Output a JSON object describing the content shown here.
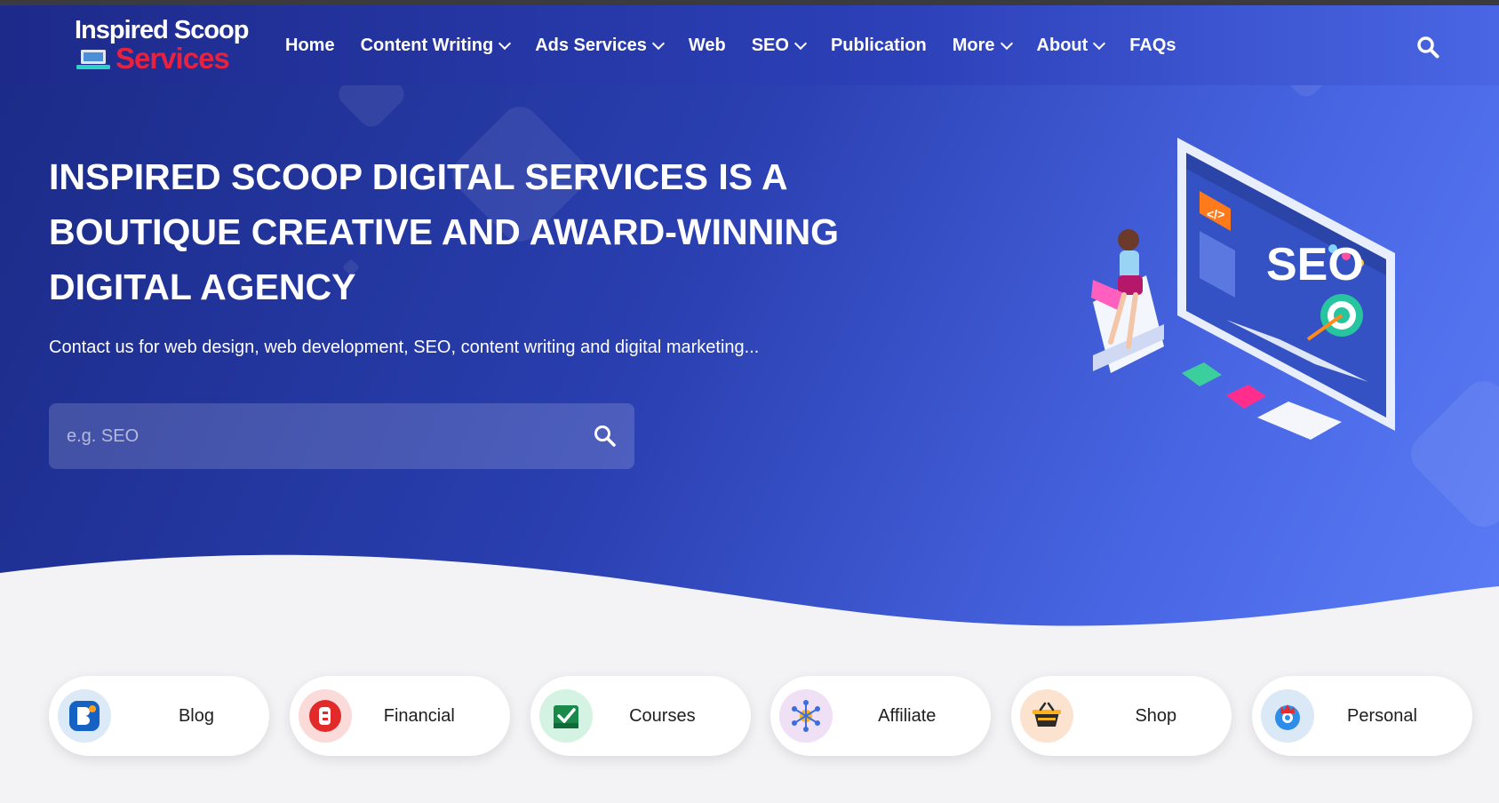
{
  "brand": {
    "logo_top": "Inspired Scoop",
    "logo_bottom": "Services",
    "logo_icon": "laptop-icon"
  },
  "nav": {
    "items": [
      {
        "label": "Home",
        "dropdown": false
      },
      {
        "label": "Content Writing",
        "dropdown": true
      },
      {
        "label": "Ads Services",
        "dropdown": true
      },
      {
        "label": "Web",
        "dropdown": false
      },
      {
        "label": "SEO",
        "dropdown": true
      },
      {
        "label": "Publication",
        "dropdown": false
      },
      {
        "label": "More",
        "dropdown": true
      },
      {
        "label": "About",
        "dropdown": true
      },
      {
        "label": "FAQs",
        "dropdown": false
      }
    ],
    "search_icon": "search-icon"
  },
  "hero": {
    "headline": "INSPIRED SCOOP DIGITAL SERVICES IS A BOUTIQUE CREATIVE AND AWARD-WINNING DIGITAL AGENCY",
    "subline": "Contact us for web design, web development, SEO, content writing and digital marketing...",
    "search_placeholder": "e.g. SEO",
    "illustration_text": "SEO"
  },
  "categories": [
    {
      "label": "Blog",
      "icon": "blog-icon",
      "bg": "#dce9f7"
    },
    {
      "label": "Financial",
      "icon": "blogger-icon",
      "bg": "#fbdada"
    },
    {
      "label": "Courses",
      "icon": "courses-icon",
      "bg": "#d4f3e3"
    },
    {
      "label": "Affiliate",
      "icon": "affiliate-network-icon",
      "bg": "#efe0f6"
    },
    {
      "label": "Shop",
      "icon": "shop-basket-icon",
      "bg": "#fbe3cf"
    },
    {
      "label": "Personal",
      "icon": "personal-icon",
      "bg": "#dbe8f6"
    }
  ],
  "colors": {
    "hero_dark": "#1a2a86",
    "hero_light": "#5a7bf5",
    "logo_red": "#e8213f",
    "page_bg": "#f3f3f5"
  }
}
